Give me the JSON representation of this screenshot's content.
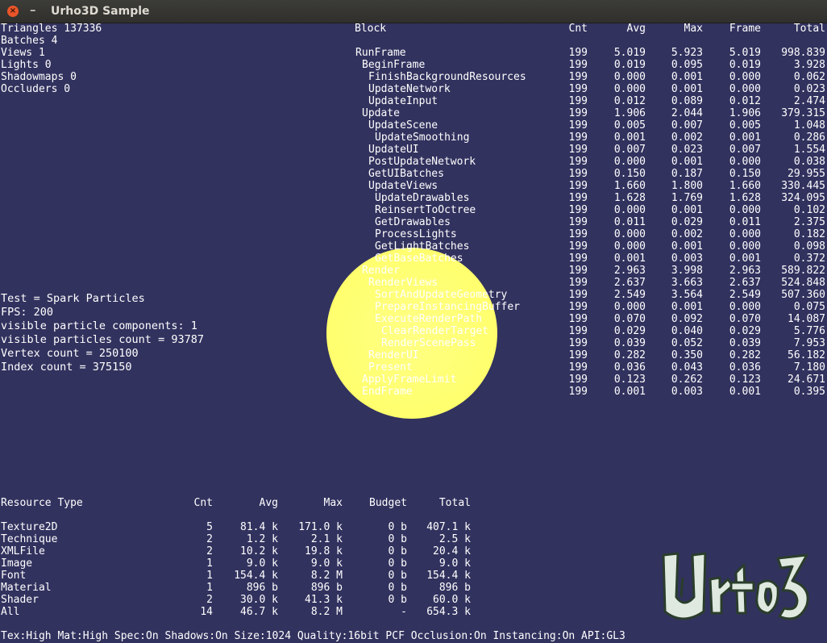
{
  "window": {
    "title": "Urho3D Sample",
    "close_glyph": "×",
    "minimize_glyph": "–"
  },
  "stats": [
    "Triangles 137336",
    "Batches 4",
    "Views 1",
    "Lights 0",
    "Shadowmaps 0",
    "Occluders 0"
  ],
  "info": {
    "test": "Test = Spark Particles",
    "fps": "FPS: 200",
    "components": "visible particle components: 1",
    "particles": "visible particles count = 93787",
    "vertex": "Vertex count = 250100",
    "index": "Index count = 375150"
  },
  "profiler": {
    "headers": [
      "Block",
      "Cnt",
      "Avg",
      "Max",
      "Frame",
      "Total"
    ],
    "rows": [
      {
        "block": "RunFrame",
        "indent": 0,
        "cnt": "199",
        "avg": "5.019",
        "max": "5.923",
        "frame": "5.019",
        "total": "998.839"
      },
      {
        "block": "BeginFrame",
        "indent": 1,
        "cnt": "199",
        "avg": "0.019",
        "max": "0.095",
        "frame": "0.019",
        "total": "3.928"
      },
      {
        "block": "FinishBackgroundResources",
        "indent": 2,
        "cnt": "199",
        "avg": "0.000",
        "max": "0.001",
        "frame": "0.000",
        "total": "0.062"
      },
      {
        "block": "UpdateNetwork",
        "indent": 2,
        "cnt": "199",
        "avg": "0.000",
        "max": "0.001",
        "frame": "0.000",
        "total": "0.023"
      },
      {
        "block": "UpdateInput",
        "indent": 2,
        "cnt": "199",
        "avg": "0.012",
        "max": "0.089",
        "frame": "0.012",
        "total": "2.474"
      },
      {
        "block": "Update",
        "indent": 1,
        "cnt": "199",
        "avg": "1.906",
        "max": "2.044",
        "frame": "1.906",
        "total": "379.315"
      },
      {
        "block": "UpdateScene",
        "indent": 2,
        "cnt": "199",
        "avg": "0.005",
        "max": "0.007",
        "frame": "0.005",
        "total": "1.048"
      },
      {
        "block": "UpdateSmoothing",
        "indent": 3,
        "cnt": "199",
        "avg": "0.001",
        "max": "0.002",
        "frame": "0.001",
        "total": "0.286"
      },
      {
        "block": "UpdateUI",
        "indent": 2,
        "cnt": "199",
        "avg": "0.007",
        "max": "0.023",
        "frame": "0.007",
        "total": "1.554"
      },
      {
        "block": "PostUpdateNetwork",
        "indent": 2,
        "cnt": "199",
        "avg": "0.000",
        "max": "0.001",
        "frame": "0.000",
        "total": "0.038"
      },
      {
        "block": "GetUIBatches",
        "indent": 2,
        "cnt": "199",
        "avg": "0.150",
        "max": "0.187",
        "frame": "0.150",
        "total": "29.955"
      },
      {
        "block": "UpdateViews",
        "indent": 2,
        "cnt": "199",
        "avg": "1.660",
        "max": "1.800",
        "frame": "1.660",
        "total": "330.445"
      },
      {
        "block": "UpdateDrawables",
        "indent": 3,
        "cnt": "199",
        "avg": "1.628",
        "max": "1.769",
        "frame": "1.628",
        "total": "324.095"
      },
      {
        "block": "ReinsertToOctree",
        "indent": 3,
        "cnt": "199",
        "avg": "0.000",
        "max": "0.001",
        "frame": "0.000",
        "total": "0.102"
      },
      {
        "block": "GetDrawables",
        "indent": 3,
        "cnt": "199",
        "avg": "0.011",
        "max": "0.029",
        "frame": "0.011",
        "total": "2.375"
      },
      {
        "block": "ProcessLights",
        "indent": 3,
        "cnt": "199",
        "avg": "0.000",
        "max": "0.002",
        "frame": "0.000",
        "total": "0.182"
      },
      {
        "block": "GetLightBatches",
        "indent": 3,
        "cnt": "199",
        "avg": "0.000",
        "max": "0.001",
        "frame": "0.000",
        "total": "0.098"
      },
      {
        "block": "GetBaseBatches",
        "indent": 3,
        "cnt": "199",
        "avg": "0.001",
        "max": "0.003",
        "frame": "0.001",
        "total": "0.372"
      },
      {
        "block": "Render",
        "indent": 1,
        "cnt": "199",
        "avg": "2.963",
        "max": "3.998",
        "frame": "2.963",
        "total": "589.822"
      },
      {
        "block": "RenderViews",
        "indent": 2,
        "cnt": "199",
        "avg": "2.637",
        "max": "3.663",
        "frame": "2.637",
        "total": "524.848"
      },
      {
        "block": "SortAndUpdateGeometry",
        "indent": 3,
        "cnt": "199",
        "avg": "2.549",
        "max": "3.564",
        "frame": "2.549",
        "total": "507.360"
      },
      {
        "block": "PrepareInstancingBuffer",
        "indent": 3,
        "cnt": "199",
        "avg": "0.000",
        "max": "0.001",
        "frame": "0.000",
        "total": "0.075"
      },
      {
        "block": "ExecuteRenderPath",
        "indent": 3,
        "cnt": "199",
        "avg": "0.070",
        "max": "0.092",
        "frame": "0.070",
        "total": "14.087"
      },
      {
        "block": "ClearRenderTarget",
        "indent": 4,
        "cnt": "199",
        "avg": "0.029",
        "max": "0.040",
        "frame": "0.029",
        "total": "5.776"
      },
      {
        "block": "RenderScenePass",
        "indent": 4,
        "cnt": "199",
        "avg": "0.039",
        "max": "0.052",
        "frame": "0.039",
        "total": "7.953"
      },
      {
        "block": "RenderUI",
        "indent": 2,
        "cnt": "199",
        "avg": "0.282",
        "max": "0.350",
        "frame": "0.282",
        "total": "56.182"
      },
      {
        "block": "Present",
        "indent": 2,
        "cnt": "199",
        "avg": "0.036",
        "max": "0.043",
        "frame": "0.036",
        "total": "7.180"
      },
      {
        "block": "ApplyFrameLimit",
        "indent": 1,
        "cnt": "199",
        "avg": "0.123",
        "max": "0.262",
        "frame": "0.123",
        "total": "24.671"
      },
      {
        "block": "EndFrame",
        "indent": 1,
        "cnt": "199",
        "avg": "0.001",
        "max": "0.003",
        "frame": "0.001",
        "total": "0.395"
      }
    ]
  },
  "resources": {
    "headers": [
      "Resource Type",
      "Cnt",
      "Avg",
      "Max",
      "Budget",
      "Total"
    ],
    "rows": [
      {
        "type": "Texture2D",
        "cnt": "5",
        "avg": "81.4 k",
        "max": "171.0 k",
        "budget": "0 b",
        "total": "407.1 k"
      },
      {
        "type": "Technique",
        "cnt": "2",
        "avg": "1.2 k",
        "max": "2.1 k",
        "budget": "0 b",
        "total": "2.5 k"
      },
      {
        "type": "XMLFile",
        "cnt": "2",
        "avg": "10.2 k",
        "max": "19.8 k",
        "budget": "0 b",
        "total": "20.4 k"
      },
      {
        "type": "Image",
        "cnt": "1",
        "avg": "9.0 k",
        "max": "9.0 k",
        "budget": "0 b",
        "total": "9.0 k"
      },
      {
        "type": "Font",
        "cnt": "1",
        "avg": "154.4 k",
        "max": "8.2 M",
        "budget": "0 b",
        "total": "154.4 k"
      },
      {
        "type": "Material",
        "cnt": "1",
        "avg": "896 b",
        "max": "896 b",
        "budget": "0 b",
        "total": "896 b"
      },
      {
        "type": "Shader",
        "cnt": "2",
        "avg": "30.0 k",
        "max": "41.3 k",
        "budget": "0 b",
        "total": "60.0 k"
      },
      {
        "type": "All",
        "cnt": "14",
        "avg": "46.7 k",
        "max": "8.2 M",
        "budget": "-",
        "total": "654.3 k"
      }
    ]
  },
  "settings_line": "Tex:High Mat:High Spec:On Shadows:On Size:1024 Quality:16bit PCF Occlusion:On Instancing:On API:GL3",
  "logo": {
    "icon": "urho3d-logo-icon",
    "text": "Urho3D"
  },
  "colors": {
    "background": "#32325f",
    "glow_core": "#ffff6e",
    "glow_rim": "#ff8458",
    "text": "#ffffff"
  }
}
